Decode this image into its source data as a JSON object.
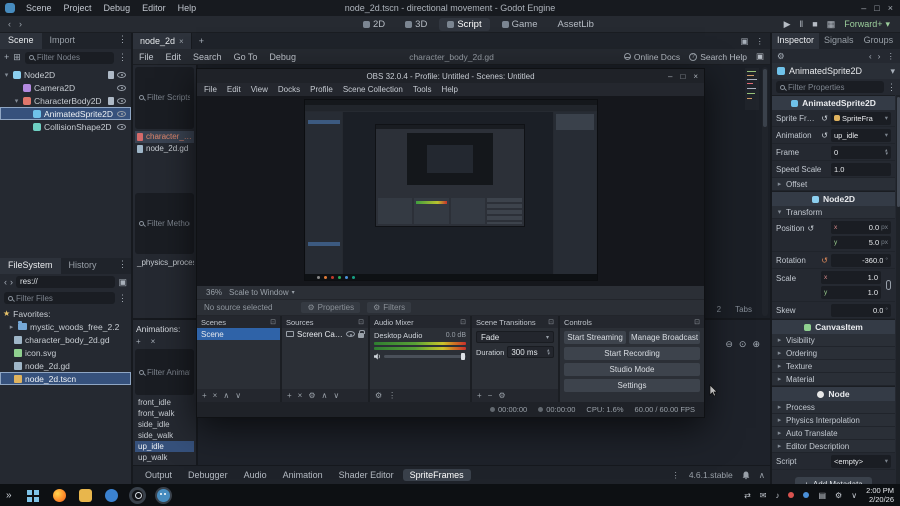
{
  "icons": {
    "minimize": "–",
    "maximize": "□",
    "close": "×",
    "caret_down": "▾",
    "caret_right": "▸",
    "chevron_left": "‹",
    "chevron_right": "›",
    "plus": "+",
    "minus": "−",
    "dots_v": "⋮",
    "play": "▶",
    "pause": "‖",
    "stop": "■",
    "movie": "▦",
    "revert": "↺",
    "gear": "⚙",
    "instance": "⊞",
    "expand": "▣",
    "float": "⊡",
    "zoom_out": "⊖",
    "zoom_reset": "⊙",
    "zoom_in": "⊕",
    "up": "∧",
    "down": "∨",
    "help": "?",
    "guillemets": "»",
    "star": "★"
  },
  "colors": {
    "godot_accent": "#478cbf",
    "selection_blue": "#36517c",
    "obs_selection": "#2f63a8",
    "renderer_green": "#9ccf9c",
    "meter_green": "#2f7d31",
    "meter_red": "#c9302c"
  },
  "godot": {
    "titlebar": {
      "title": "node_2d.tscn - directional movement - Godot Engine",
      "menus": [
        "Scene",
        "Project",
        "Debug",
        "Editor",
        "Help"
      ]
    },
    "workspace": {
      "tabs": [
        "2D",
        "3D",
        "Script",
        "Game",
        "AssetLib"
      ],
      "renderer": "Forward+"
    },
    "scene_dock": {
      "tabs": [
        "Scene",
        "Import"
      ],
      "filter_placeholder": "Filter Nodes",
      "tree": [
        "Node2D",
        "Camera2D",
        "CharacterBody2D",
        "AnimatedSprite2D",
        "CollisionShape2D"
      ]
    },
    "filesystem": {
      "tabs": [
        "FileSystem",
        "History"
      ],
      "path": "res://",
      "filter_placeholder": "Filter Files",
      "favorites_label": "Favorites:",
      "files": [
        "mystic_woods_free_2.2",
        "character_body_2d.gd",
        "icon.svg",
        "node_2d.gd",
        "node_2d.tscn"
      ]
    },
    "script_editor": {
      "scene_tab": "node_2d",
      "menus": [
        "File",
        "Edit",
        "Search",
        "Go To",
        "Debug"
      ],
      "file_name": "character_body_2d.gd",
      "online_docs": "Online Docs",
      "search_help": "Search Help",
      "filter_scripts_placeholder": "Filter Scripts",
      "scripts": [
        "character_bo",
        "node_2d.gd"
      ],
      "filter_methods_placeholder": "Filter Methods",
      "methods": [
        "_physics_process"
      ],
      "status": [
        "2",
        "Tabs"
      ]
    },
    "spriteframes": {
      "animations_label": "Animations:",
      "filter_placeholder": "Filter Animations",
      "animations": [
        "front_idle",
        "front_walk",
        "side_idle",
        "side_walk",
        "up_idle",
        "up_walk"
      ]
    },
    "bottom_bar": {
      "tabs": [
        "Output",
        "Debugger",
        "Audio",
        "Animation",
        "Shader Editor",
        "SpriteFrames"
      ],
      "version": "4.6.1.stable"
    },
    "inspector": {
      "tabs": [
        "Inspector",
        "Signals",
        "Groups"
      ],
      "node_name": "AnimatedSprite2D",
      "filter_placeholder": "Filter Properties",
      "cat_animated_sprite": "AnimatedSprite2D",
      "sprite_frames_label": "Sprite Frames",
      "sprite_frames_value": "SpriteFra",
      "animation_label": "Animation",
      "animation_value": "up_idle",
      "frame_label": "Frame",
      "frame_value": "0",
      "speed_scale_label": "Speed Scale",
      "speed_scale_value": "1.0",
      "offset_group": "Offset",
      "cat_node2d": "Node2D",
      "transform_group": "Transform",
      "position_label": "Position",
      "position_x": "0.0",
      "position_y": "5.0",
      "px_suffix": "px",
      "rotation_label": "Rotation",
      "rotation_value": "-360.0",
      "deg_suffix": "°",
      "scale_label": "Scale",
      "scale_x": "1.0",
      "scale_y": "1.0",
      "skew_label": "Skew",
      "skew_value": "0.0",
      "axis_x": "x",
      "axis_y": "y",
      "cat_canvasitem": "CanvasItem",
      "canvasitem_groups": [
        "Visibility",
        "Ordering",
        "Texture",
        "Material"
      ],
      "cat_node": "Node",
      "node_groups": [
        "Process",
        "Physics Interpolation",
        "Auto Translate",
        "Editor Description"
      ],
      "script_label": "Script",
      "script_value": "<empty>",
      "add_metadata": "Add Metadata"
    }
  },
  "obs": {
    "title": "OBS 32.0.4 - Profile: Untitled - Scenes: Untitled",
    "menus": [
      "File",
      "Edit",
      "View",
      "Docks",
      "Profile",
      "Scene Collection",
      "Tools",
      "Help"
    ],
    "preview": {
      "zoom": "36%",
      "scale_mode": "Scale to Window"
    },
    "source_bar": {
      "message": "No source selected",
      "properties_label": "Properties",
      "filters_label": "Filters"
    },
    "docks": {
      "scenes": {
        "title": "Scenes",
        "items": [
          "Scene"
        ]
      },
      "sources": {
        "title": "Sources",
        "items": [
          "Screen Capture"
        ]
      },
      "audio": {
        "title": "Audio Mixer",
        "channel": "Desktop Audio",
        "level": "0.0 dB"
      },
      "transitions": {
        "title": "Scene Transitions",
        "transition": "Fade",
        "duration_label": "Duration",
        "duration": "300 ms"
      },
      "controls": {
        "title": "Controls",
        "buttons": [
          "Start Streaming",
          "Manage Broadcast",
          "Start Recording",
          "Studio Mode",
          "Settings"
        ]
      }
    },
    "status": {
      "rec_time": "00:00:00",
      "stream_time": "00:00:00",
      "cpu": "CPU: 1.6%",
      "fps": "60.00 / 60.00 FPS"
    }
  },
  "taskbar": {
    "clock_time": "2:00 PM",
    "clock_date": "2/20/26"
  }
}
